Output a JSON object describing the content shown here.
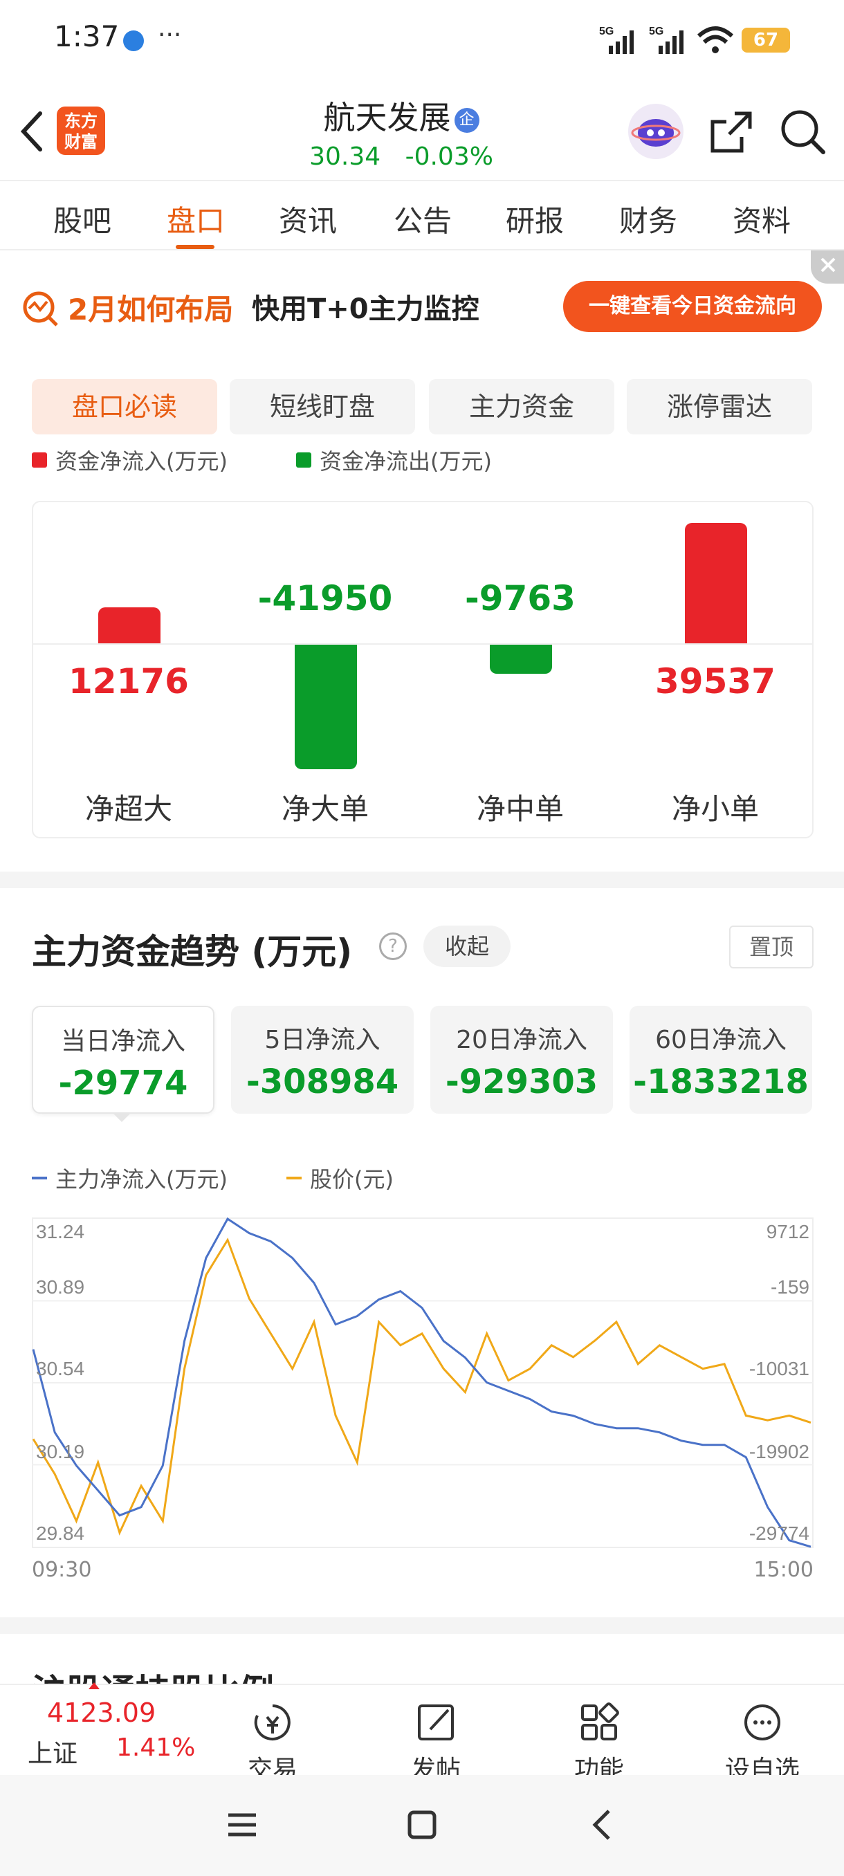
{
  "status_bar": {
    "time": "1:37",
    "more": "···",
    "signal1": "5G",
    "signal2": "5G",
    "battery": "67"
  },
  "header": {
    "app_logo_line1": "东方",
    "app_logo_line2": "财富",
    "stock_name": "航天发展",
    "badge": "企",
    "price": "30.34",
    "change": "-0.03%"
  },
  "tabs": [
    "股吧",
    "盘口",
    "资讯",
    "公告",
    "研报",
    "财务",
    "资料"
  ],
  "banner": {
    "title": "2月如何布局",
    "subtitle": "快用T+0主力监控",
    "button": "一键查看今日资金流向"
  },
  "subtabs": [
    "盘口必读",
    "短线盯盘",
    "主力资金",
    "涨停雷达"
  ],
  "flow_legend": {
    "inflow": "资金净流入(万元)",
    "outflow": "资金净流出(万元)"
  },
  "flow": [
    {
      "label": "净超大",
      "value": "12176",
      "num": 12176
    },
    {
      "label": "净大单",
      "value": "-41950",
      "num": -41950
    },
    {
      "label": "净中单",
      "value": "-9763",
      "num": -9763
    },
    {
      "label": "净小单",
      "value": "39537",
      "num": 39537
    }
  ],
  "trend": {
    "title": "主力资金趋势 (万元)",
    "collapse": "收起",
    "pin": "置顶",
    "cards": [
      {
        "label": "当日净流入",
        "value": "-29774"
      },
      {
        "label": "5日净流入",
        "value": "-308984"
      },
      {
        "label": "20日净流入",
        "value": "-929303"
      },
      {
        "label": "60日净流入",
        "value": "-1833218"
      }
    ],
    "legend_main": "主力净流入(万元)",
    "legend_price": "股价(元)"
  },
  "chart_data": {
    "type": "line",
    "x_start": "09:30",
    "x_end": "15:00",
    "left_ticks": [
      "31.24",
      "30.89",
      "30.54",
      "30.19",
      "29.84"
    ],
    "right_ticks": [
      "9712",
      "-159",
      "-10031",
      "-19902",
      "-29774"
    ],
    "series": [
      {
        "name": "主力净流入(万元)",
        "color": "#4a72c8",
        "values": [
          -6000,
          -16000,
          -20000,
          -23000,
          -26000,
          -25000,
          -20000,
          -5000,
          5000,
          9712,
          8000,
          7000,
          5000,
          2000,
          -3000,
          -2000,
          0,
          1000,
          -1000,
          -5000,
          -7000,
          -10000,
          -11000,
          -12000,
          -13500,
          -14000,
          -15000,
          -15500,
          -15500,
          -16000,
          -17000,
          -17500,
          -17500,
          -19000,
          -25000,
          -29000,
          -29774
        ]
      },
      {
        "name": "股价(元)",
        "color": "#f0a818",
        "values": [
          30.3,
          30.15,
          29.95,
          30.2,
          29.9,
          30.1,
          29.95,
          30.6,
          31.0,
          31.15,
          30.9,
          30.75,
          30.6,
          30.8,
          30.4,
          30.2,
          30.8,
          30.7,
          30.75,
          30.6,
          30.5,
          30.75,
          30.55,
          30.6,
          30.7,
          30.65,
          30.72,
          30.8,
          30.62,
          30.7,
          30.65,
          30.6,
          30.62,
          30.4,
          30.38,
          30.4,
          30.37
        ]
      }
    ]
  },
  "next_section_title": "沪股通持股比例",
  "bottom_nav": {
    "index_value": "4123.09",
    "index_name": "上证",
    "index_change": "1.41%",
    "items": [
      "交易",
      "发帖",
      "功能",
      "设自选"
    ]
  }
}
